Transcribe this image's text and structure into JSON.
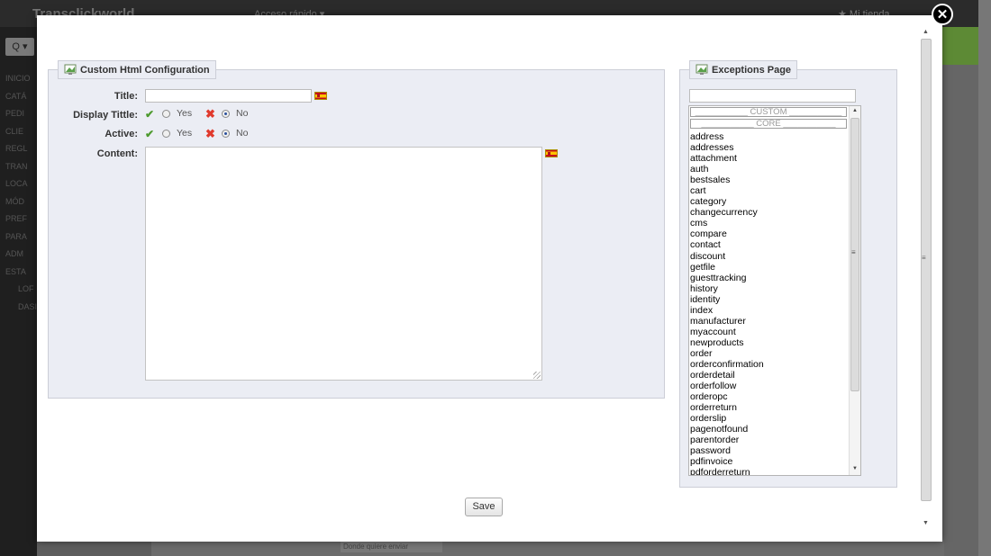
{
  "background": {
    "brand": "Transclickworld",
    "quick_access": "Acceso rápido ▾",
    "my_store": "★ Mi tienda",
    "search_button": "Q ▾",
    "nav_items": [
      "INICIO",
      "CATÁ",
      "PEDI",
      "CLIE",
      "REGL",
      "TRAN",
      "LOCA",
      "MÓD",
      "PREF",
      "PARA",
      "ADM",
      "ESTA",
      "LOF",
      "DASI"
    ],
    "bottom_field": "Donde quiere enviar"
  },
  "modal": {
    "close_label": "✕",
    "config_panel": {
      "legend": "Custom Html Configuration",
      "title_label": "Title:",
      "title_value": "",
      "display_title_label": "Display Tittle:",
      "active_label": "Active:",
      "content_label": "Content:",
      "yes_label": "Yes",
      "no_label": "No",
      "display_title_selected": "No",
      "active_selected": "No"
    },
    "exceptions_panel": {
      "legend": "Exceptions Page",
      "filter_value": "",
      "group_custom": "___________ CUSTOM ___________",
      "group_core": "___________ CORE ___________",
      "pages": [
        "address",
        "addresses",
        "attachment",
        "auth",
        "bestsales",
        "cart",
        "category",
        "changecurrency",
        "cms",
        "compare",
        "contact",
        "discount",
        "getfile",
        "guesttracking",
        "history",
        "identity",
        "index",
        "manufacturer",
        "myaccount",
        "newproducts",
        "order",
        "orderconfirmation",
        "orderdetail",
        "orderfollow",
        "orderopc",
        "orderreturn",
        "orderslip",
        "pagenotfound",
        "parentorder",
        "password",
        "pdfinvoice",
        "pdforderreturn"
      ]
    },
    "save_label": "Save"
  },
  "colors": {
    "panel_bg": "#ebedf4",
    "check_green": "#4d9a2e",
    "cross_red": "#e03a2d"
  }
}
